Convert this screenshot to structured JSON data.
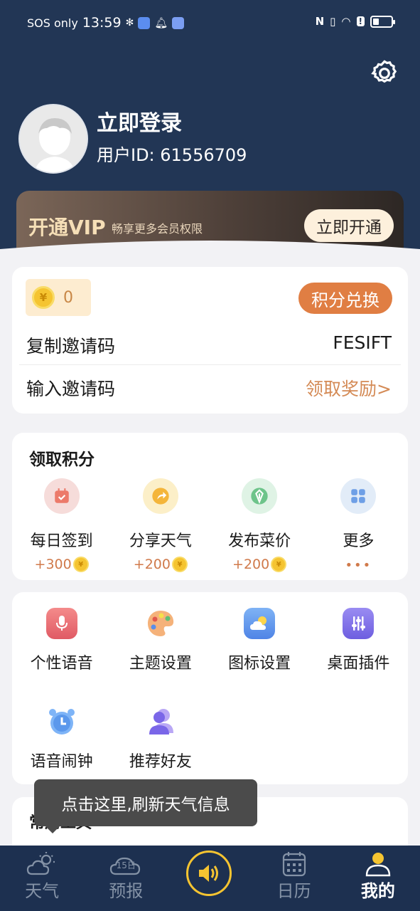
{
  "status_bar": {
    "carrier": "SOS only",
    "time": "13:59"
  },
  "profile": {
    "login_title": "立即登录",
    "user_id": "用户ID: 61556709"
  },
  "vip": {
    "title": "开通VIP",
    "subtitle": "畅享更多会员权限",
    "button_label": "立即开通"
  },
  "points": {
    "coin_symbol": "¥",
    "count": "0",
    "exchange_label": "积分兑换",
    "copy_code_label": "复制邀请码",
    "invite_code": "FESIFT",
    "enter_code_label": "输入邀请码",
    "claim_reward_label": "领取奖励>"
  },
  "earn_points": {
    "title": "领取积分",
    "items": [
      {
        "label": "每日签到",
        "points": "+300",
        "icon": "calendar-check-icon",
        "color": "#f3d9d7"
      },
      {
        "label": "分享天气",
        "points": "+200",
        "icon": "share-arrow-icon",
        "color": "#fcefc8"
      },
      {
        "label": "发布菜价",
        "points": "+200",
        "icon": "price-tag-icon",
        "color": "#dff3e5"
      },
      {
        "label": "更多",
        "points": "",
        "icon": "grid-more-icon",
        "color": "#e2ecf8"
      }
    ],
    "more_dots": "•••"
  },
  "tools": {
    "items": [
      {
        "label": "个性语音",
        "icon": "microphone-icon"
      },
      {
        "label": "主题设置",
        "icon": "palette-icon"
      },
      {
        "label": "图标设置",
        "icon": "weather-icon-settings-icon"
      },
      {
        "label": "桌面插件",
        "icon": "sliders-icon"
      },
      {
        "label": "语音闹钟",
        "icon": "alarm-clock-icon"
      },
      {
        "label": "推荐好友",
        "icon": "friends-icon"
      }
    ]
  },
  "next_section": {
    "title": "常用工具"
  },
  "tooltip": {
    "text": "点击这里,刷新天气信息"
  },
  "tabbar": {
    "tabs": [
      {
        "label": "天气",
        "icon": "weather-cloud-icon"
      },
      {
        "label": "预报",
        "icon": "forecast-15day-icon",
        "badge": "15日"
      },
      {
        "label": "",
        "icon": "speaker-icon"
      },
      {
        "label": "日历",
        "icon": "calendar-icon"
      },
      {
        "label": "我的",
        "icon": "profile-icon"
      }
    ],
    "active": "我的"
  }
}
